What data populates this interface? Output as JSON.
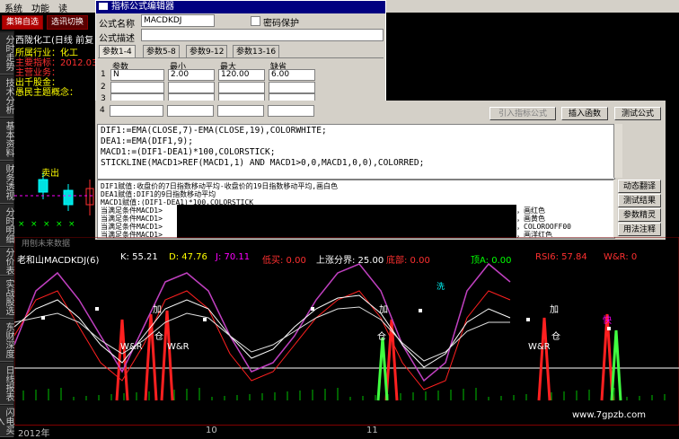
{
  "menu": {
    "items": [
      "系统",
      "功能",
      "读"
    ]
  },
  "toolbar": {
    "btn1": "集锦自选",
    "btn2": "选讯切换"
  },
  "left_tabs": [
    "分时走势",
    "技术分析",
    "基本资料",
    "财务透视",
    "分时明细",
    "分价表",
    "实战股选",
    "东财深度",
    "日线报表",
    "闪电买入"
  ],
  "stock": {
    "title": "西陇化工(日线 前复",
    "industry_label": "所属行业：化工",
    "indicator_label": "主要指标：2012.03",
    "business_label": "主营业务：",
    "count_label": "出千股金：",
    "concept_label": "愚民主题概念："
  },
  "chart_upper": {
    "sell_label": "卖出",
    "no_data": "用刨未来数据"
  },
  "dialog": {
    "title": "指标公式编辑器",
    "name_label": "公式名称",
    "name_value": "MACDKDJ",
    "password_label": "密码保护",
    "desc_label": "公式描述",
    "tabs": [
      "参数1-4",
      "参数5-8",
      "参数9-12",
      "参数13-16"
    ],
    "grid_headers": [
      "参数",
      "最小",
      "最大",
      "缺省"
    ],
    "rows": [
      {
        "idx": "1",
        "name": "N",
        "min": "2.00",
        "max": "120.00",
        "def": "6.00"
      },
      {
        "idx": "2",
        "name": "",
        "min": "",
        "max": "",
        "def": ""
      },
      {
        "idx": "3",
        "name": "",
        "min": "",
        "max": "",
        "def": ""
      },
      {
        "idx": "4",
        "name": "",
        "min": "",
        "max": "",
        "def": ""
      }
    ]
  },
  "editor": {
    "import_btn": "引入指标公式",
    "insert_func_btn": "插入函数",
    "test_btn": "测试公式",
    "code_lines": [
      "DIF1:=EMA(CLOSE,7)-EMA(CLOSE,19),COLORWHITE;",
      "DEA1:=EMA(DIF1,9);",
      "MACD1:=(DIF1-DEA1)*100,COLORSTICK;",
      "STICKLINE(MACD1>REF(MACD1,1) AND MACD1>0,0,MACD1,0,0),COLORRED;"
    ],
    "desc_lines": [
      "DIF1赋值:收盘价的7日指数移动平均-收盘价的19日指数移动平均,画白色",
      "DEA1赋值:DIF1的9日指数移动平均",
      "MACD1赋值:(DIF1-DEA1)*100,COLORSTICK",
      "当满足条件MACD1>",
      "当满足条件MACD1>",
      "当满足条件MACD1>",
      "当满足条件MACD1>"
    ],
    "desc_tails": [
      "柱，画红色",
      "柱，画黄色",
      "柱，COLOROOFF00",
      "柱，画洋红色"
    ],
    "side_buttons": [
      "动态翻译",
      "测试结果",
      "参数精灵",
      "用法注释"
    ]
  },
  "indicator": {
    "name": "老和山MACDKDJ(6)",
    "k": "K: 55.21",
    "d": "D: 47.76",
    "j": "J: 70.11",
    "low": "低买: 0.00",
    "rise": "上涨分界: 25.00",
    "bottom": "底部: 0.00",
    "top": "顶A: 0.00",
    "rsi": "RSI6: 57.84",
    "wr": "W&R: 0"
  },
  "chart_labels": {
    "jia": "加",
    "cang": "仓",
    "wr": "W&R",
    "kuai": "快",
    "xi": "洗"
  },
  "date_axis": {
    "year": "2012年",
    "m10": "10",
    "m11": "11"
  },
  "watermark": "www.7gpzb.com",
  "colors": {
    "dialog_title": "#000080",
    "k_color": "#ffffff",
    "d_color": "#ffff00",
    "j_color": "#ff00ff",
    "red": "#ff0000"
  }
}
